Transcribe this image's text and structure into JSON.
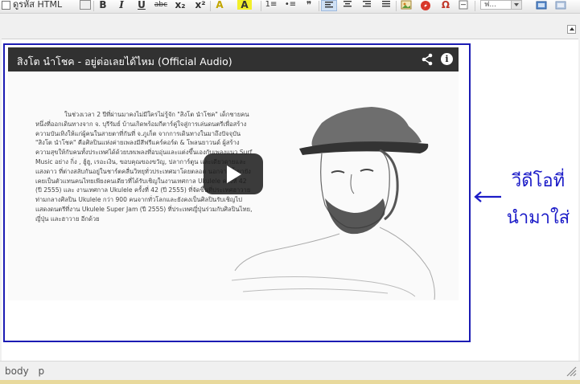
{
  "toolbar": {
    "source_label": "ดูรหัส HTML",
    "bold_label": "B",
    "italic_label": "I",
    "underline_label": "U",
    "strike_label": "abc",
    "subscript_label": "x₂",
    "superscript_label": "x²",
    "text_color_label": "A",
    "bg_color_label": "A",
    "numbered_list_label": "1≡",
    "bullet_list_label": "•≡",
    "blockquote_label": "❞",
    "special_char_label": "Ω",
    "font_select_value": "ฟ..."
  },
  "video": {
    "title": "สิงโต นำโชค - อยู่ต่อเลยได้ไหม (Official Audio)",
    "body_text": "ในช่วงเวลา 2 ปีที่ผ่านมาคงไม่มีใครไม่รู้จัก \"สิงโต นำโชค\" เด็กชายคนหนึ่งที่ออกเดินทางจาก จ. บุรีรัมย์ บ้านเกิดพร้อมกีตาร์คู่ใจสู่การเล่นดนตรีเพื่อสร้างความบันเทิงให้แก่ผู้คนในสายตาที่กันที่ จ.ภูเก็ต จากการเดินทางในมาถึงปัจจุบัน \"สิงโต นำโชค\" คือศิลปินแห่งค่ายเพลงมีสีฟรีแคร์คอร์ด & โพลนยาวนด์ ผู้สร้างความสุขให้กับคนทั้งประเทศได้ด้วยบทเพลงที่อบอุ่นและแต่งขึ้นเองกับเพลงแนว Surf Music อย่าง กิ่ง , ฮู้ฮู, เรอะเงิน, ขอบคุณของขวัญ, ปลาการ์ตูน และเดียวดายและแสงดาว ที่ต่างสลับกันอยู่ในชาร์ตคลื่นวิทยุทั่วประเทศมาโดยตลอด นอกจากนี้เขายังเคยเป็นตัวแทนคนไทยเพียงคนเดียวที่ได้รับเชิญในงานเทศกาล Ukulele ครั้งที่ 42 (ปี 2555) และ งานเทศกาล Ukulele ครั้งที่ 42 (ปี 2555) ที่จัดขึ้นที่ประเทศฮาวายท่ามกลางศิลปิน Ukulele กว่า 900 คนจากทั่วโลกและยังคงเป็นศิลปินรับเชิญไปแสดงดนตรีที่งาน Ukulele Super Jam (ปี 2555) ที่ประเทศญี่ปุ่นร่วมกับศิลปินไทย, ญี่ปุ่น และฮาวาย อีกด้วย"
  },
  "annotation": {
    "text_line1": "วีดีโอที่",
    "text_line2": "นำมาใส่",
    "color": "#1c1cc8"
  },
  "statusbar": {
    "path": [
      "body",
      "p"
    ]
  },
  "colors": {
    "frame_border": "#1b1bb3",
    "bottom_bar": "#e8d99c"
  }
}
